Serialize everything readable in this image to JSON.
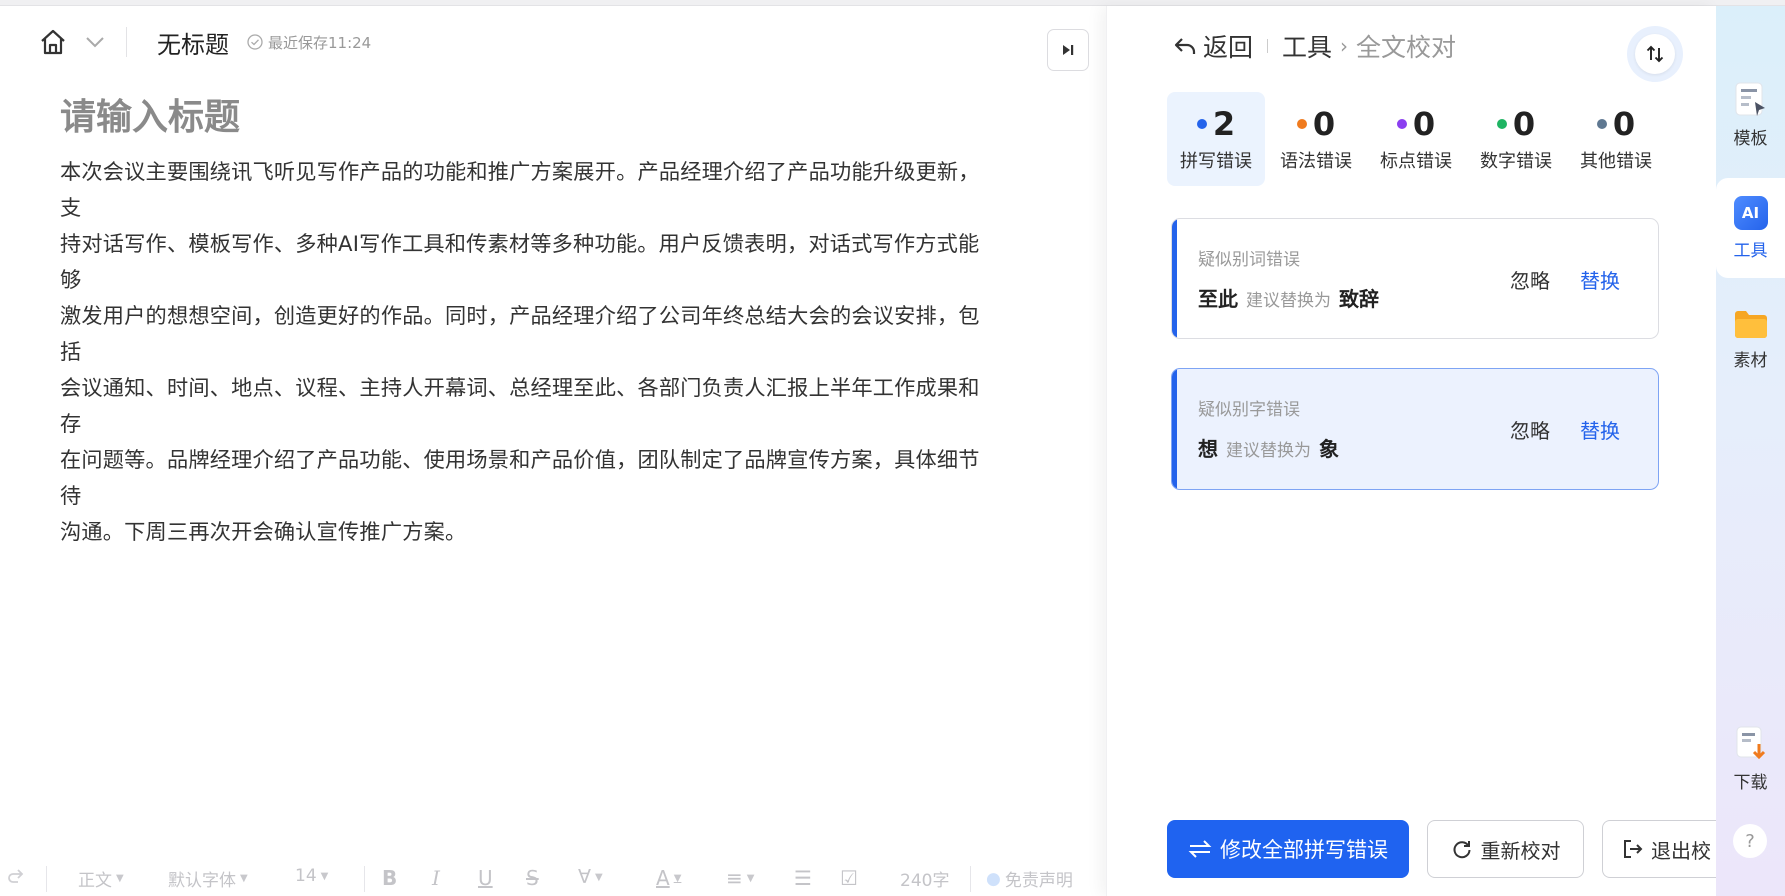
{
  "header": {
    "doc_title": "无标题",
    "saved_status": "最近保存11:24"
  },
  "editor": {
    "title_placeholder": "请输入标题",
    "body_lines": [
      "本次会议主要围绕讯飞听见写作产品的功能和推广方案展开。产品经理介绍了产品功能升级更新，支",
      "持对话写作、模板写作、多种AI写作工具和传素材等多种功能。用户反馈表明，对话式写作方式能够",
      "激发用户的想想空间，创造更好的作品。同时，产品经理介绍了公司年终总结大会的会议安排，包括",
      "会议通知、时间、地点、议程、主持人开幕词、总经理至此、各部门负责人汇报上半年工作成果和存",
      "在问题等。品牌经理介绍了产品功能、使用场景和产品价值，团队制定了品牌宣传方案，具体细节待",
      "沟通。下周三再次开会确认宣传推广方案。"
    ]
  },
  "toolbar": {
    "paragraph_style": "正文",
    "font_family": "默认字体",
    "font_size": "14",
    "word_count": "240字",
    "disclaimer": "免责声明"
  },
  "panel": {
    "back_label": "返回",
    "tools_label": "工具",
    "current_label": "全文校对",
    "categories": [
      {
        "count": "2",
        "label": "拼写错误",
        "color": "#2463eb"
      },
      {
        "count": "0",
        "label": "语法错误",
        "color": "#f07b1e"
      },
      {
        "count": "0",
        "label": "标点错误",
        "color": "#8b3ff0"
      },
      {
        "count": "0",
        "label": "数字错误",
        "color": "#1fb463"
      },
      {
        "count": "0",
        "label": "其他错误",
        "color": "#5f7891"
      }
    ],
    "errors": [
      {
        "type": "疑似别词错误",
        "word": "至此",
        "hint": "建议替换为",
        "suggestion": "致辞",
        "ignore": "忽略",
        "replace": "替换"
      },
      {
        "type": "疑似别字错误",
        "word": "想",
        "hint": "建议替换为",
        "suggestion": "象",
        "ignore": "忽略",
        "replace": "替换"
      }
    ],
    "fix_all_label": "修改全部拼写错误",
    "recheck_label": "重新校对",
    "exit_label": "退出校"
  },
  "rail": {
    "template_label": "模板",
    "ai_badge": "AI",
    "tools_label": "工具",
    "material_label": "素材",
    "download_label": "下载",
    "help_label": "?"
  }
}
